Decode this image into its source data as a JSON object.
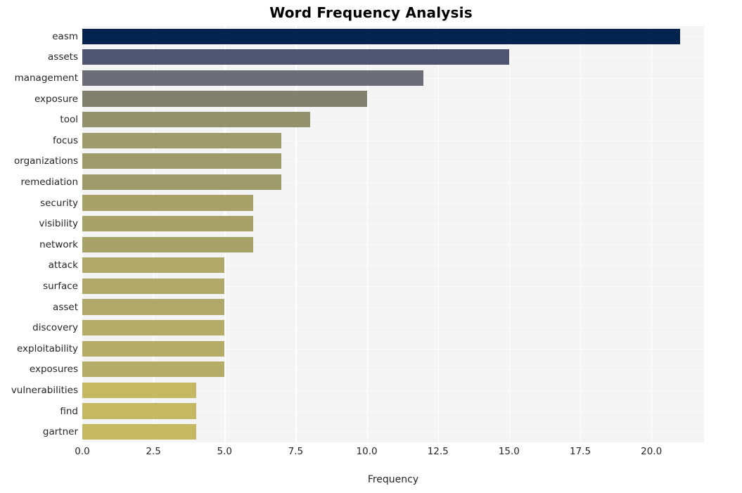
{
  "chart_data": {
    "type": "bar",
    "orientation": "horizontal",
    "title": "Word Frequency Analysis",
    "xlabel": "Frequency",
    "ylabel": "",
    "categories": [
      "easm",
      "assets",
      "management",
      "exposure",
      "tool",
      "focus",
      "organizations",
      "remediation",
      "security",
      "visibility",
      "network",
      "attack",
      "surface",
      "asset",
      "discovery",
      "exploitability",
      "exposures",
      "vulnerabilities",
      "find",
      "gartner"
    ],
    "values": [
      21,
      15,
      12,
      10,
      8,
      7,
      7,
      7,
      6,
      6,
      6,
      5,
      5,
      5,
      5,
      5,
      5,
      4,
      4,
      4
    ],
    "bar_colors": [
      "#04234f",
      "#4e5471",
      "#6b6d77",
      "#82806f",
      "#93906c",
      "#9d9a6b",
      "#9d9a6b",
      "#9d9a6b",
      "#a8a269",
      "#a8a269",
      "#a8a269",
      "#b0a869",
      "#b0a869",
      "#b0a869",
      "#b5ac68",
      "#b5ac68",
      "#b5ac68",
      "#c4b862",
      "#c4b862",
      "#c4b862"
    ],
    "xlim": [
      0,
      21.85
    ],
    "xticks": [
      0,
      2.5,
      5,
      7.5,
      10,
      12.5,
      15,
      17.5,
      20
    ],
    "xtick_labels": [
      "0.0",
      "2.5",
      "5.0",
      "7.5",
      "10.0",
      "12.5",
      "15.0",
      "17.5",
      "20.0"
    ],
    "grid": true,
    "grid_color": "#ffffff",
    "plot_background": "#f4f4f5",
    "figure_background": "#ffffff",
    "legend": null,
    "style": "seaborn-whitegrid"
  }
}
